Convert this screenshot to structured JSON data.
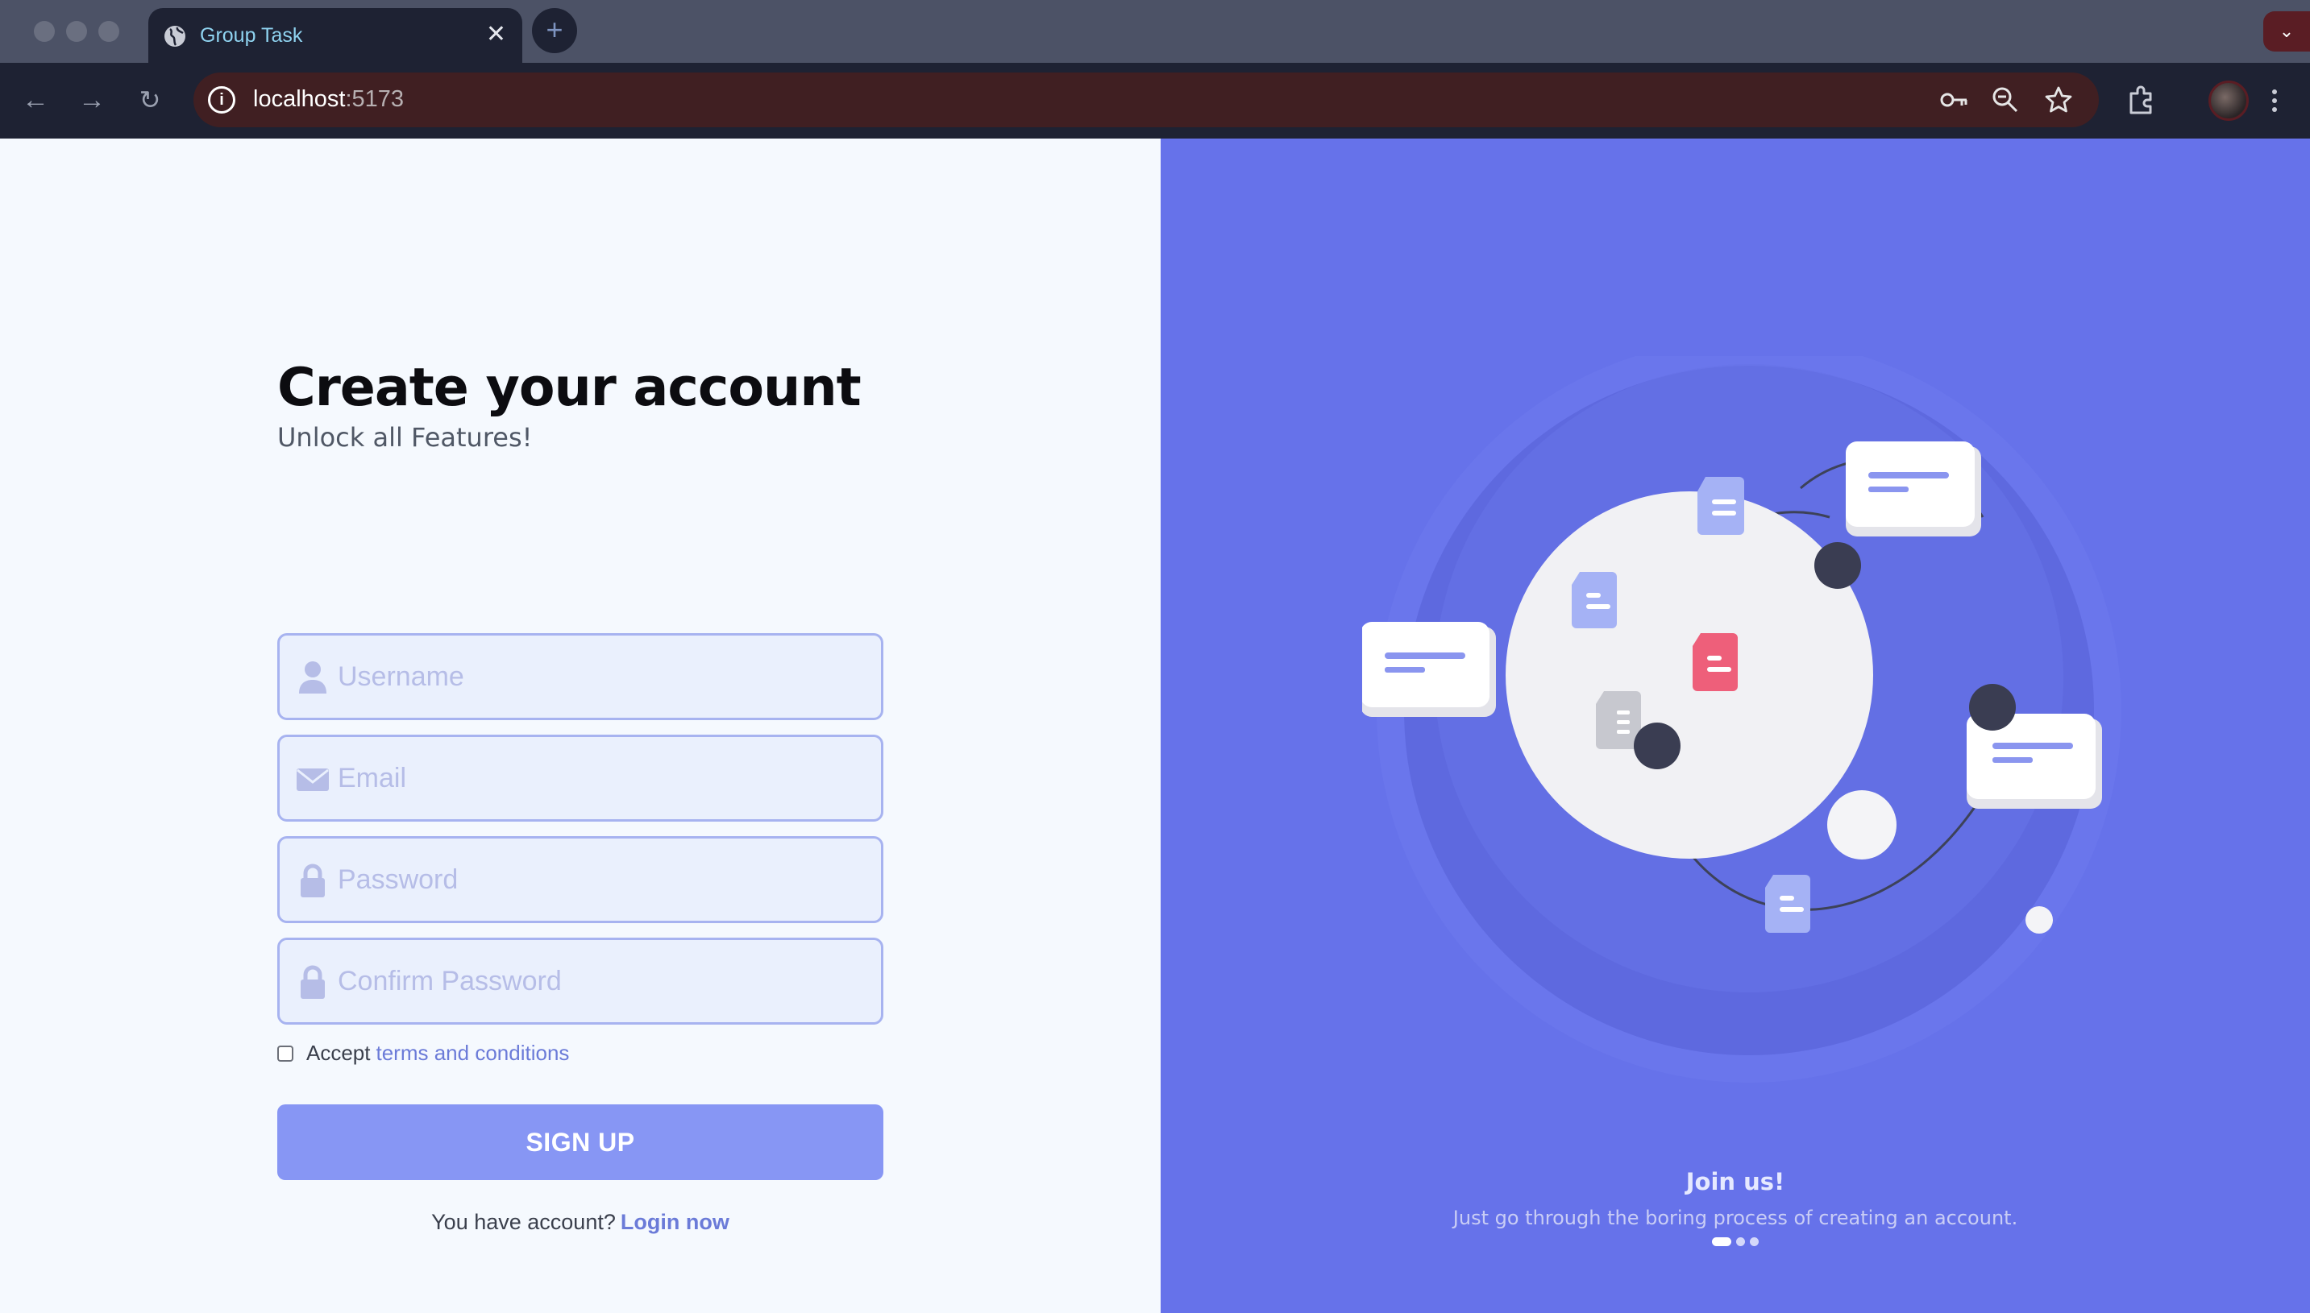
{
  "browser": {
    "tab_title": "Group Task",
    "tab_close": "✕",
    "new_tab": "+",
    "url_host": "localhost",
    "url_port": ":5173",
    "icons": [
      "globe-icon",
      "back-icon",
      "forward-icon",
      "reload-icon",
      "info-icon",
      "key-icon",
      "zoom-icon",
      "star-icon",
      "extensions-icon",
      "avatar",
      "menu-icon"
    ]
  },
  "form": {
    "title": "Create your account",
    "subtitle": "Unlock all Features!",
    "username_placeholder": "Username",
    "email_placeholder": "Email",
    "password_placeholder": "Password",
    "confirm_placeholder": "Confirm Password",
    "terms_prefix": "Accept",
    "terms_link": "terms and conditions",
    "signup_label": "SIGN UP",
    "login_prefix": "You have account?",
    "login_link": "Login now"
  },
  "promo": {
    "heading": "Join us!",
    "text": "Just go through the boring process of creating an account.",
    "slides": 3,
    "active_slide": 0
  },
  "colors": {
    "accent": "#8796f4",
    "panel": "#6672ea",
    "link": "#6b7bd8",
    "field_bg": "#eaf0fd",
    "field_border": "#a7b3f0"
  }
}
